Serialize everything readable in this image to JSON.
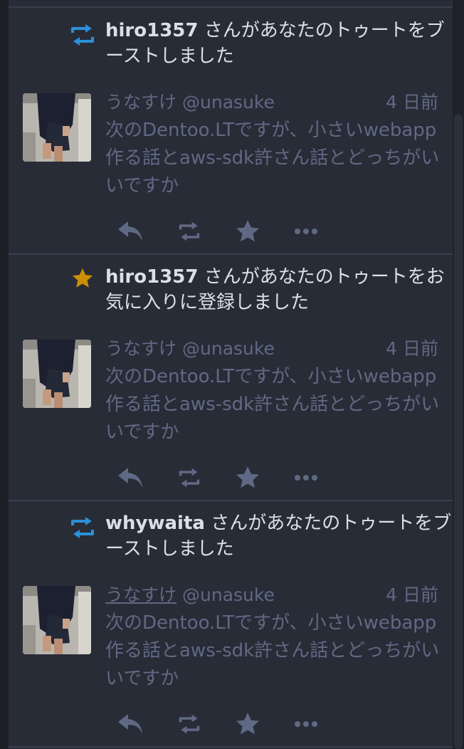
{
  "colors": {
    "background": "#282c37",
    "boost_icon": "#2b90d9",
    "favourite_icon": "#ca8f04",
    "muted_text": "#606984",
    "primary_text": "#d9e1e8"
  },
  "notifications": [
    {
      "type": "reblog",
      "icon": "boost-icon",
      "account": "hiro1357",
      "message": " さんがあなたのトゥートをブーストしました",
      "status": {
        "display_name": "うなすけ",
        "handle": "@unasuke",
        "time": "4 日前",
        "content": "次のDentoo.LTですが、小さいwebapp作る話とaws-sdk許さん話とどっちがいいですか"
      }
    },
    {
      "type": "favourite",
      "icon": "star-icon",
      "account": "hiro1357",
      "message": " さんがあなたのトゥートをお気に入りに登録しました",
      "status": {
        "display_name": "うなすけ",
        "handle": "@unasuke",
        "time": "4 日前",
        "content": "次のDentoo.LTですが、小さいwebapp作る話とaws-sdk許さん話とどっちがいいですか"
      }
    },
    {
      "type": "reblog",
      "icon": "boost-icon",
      "account": "whywaita",
      "message": " さんがあなたのトゥートをブーストしました",
      "status": {
        "display_name": "うなすけ",
        "handle": "@unasuke",
        "time": "4 日前",
        "content": "次のDentoo.LTですが、小さいwebapp作る話とaws-sdk許さん話とどっちがいいですか"
      }
    }
  ],
  "action_icons": [
    "reply-icon",
    "boost-icon",
    "favourite-icon",
    "more-icon"
  ]
}
